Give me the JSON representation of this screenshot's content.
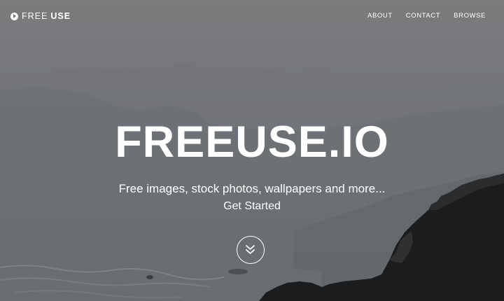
{
  "header": {
    "logo_word1": "FREE",
    "logo_word2": "USE",
    "logo_icon": "play-circle-icon",
    "nav": [
      {
        "label": "ABOUT"
      },
      {
        "label": "CONTACT"
      },
      {
        "label": "BROWSE"
      }
    ]
  },
  "hero": {
    "title": "FREEUSE.IO",
    "subtitle": "Free images, stock photos, wallpapers and more...",
    "cta_label": "Get Started",
    "scroll_icon": "double-chevron-down-icon"
  },
  "colors": {
    "text": "#ffffff",
    "background": "#707275",
    "rocks": "#1a1b1c"
  }
}
